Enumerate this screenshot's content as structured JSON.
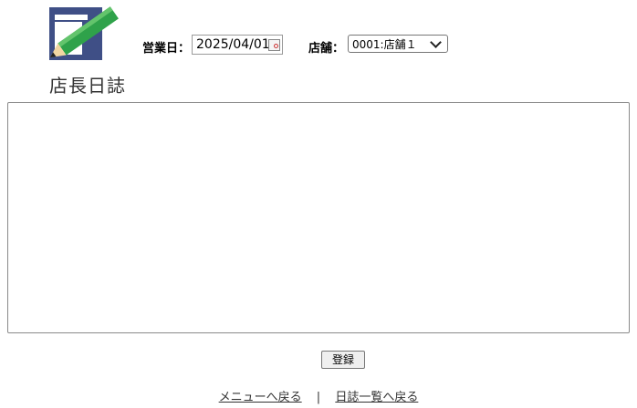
{
  "logo": {
    "text": "店長日誌",
    "icon": "pencil-notebook-icon",
    "colors": {
      "notebook": "#3f4f86",
      "pencil": "#2fa24a",
      "page": "#ffffff"
    }
  },
  "header": {
    "date_label": "営業日：",
    "date_value": "2025/04/01",
    "store_label": "店舗：",
    "store_selected": "0001:店舗１"
  },
  "main": {
    "textarea_value": ""
  },
  "actions": {
    "register_label": "登録"
  },
  "footer": {
    "menu_link": "メニューへ戻る",
    "separator": "|",
    "list_link": "日誌一覧へ戻る"
  }
}
